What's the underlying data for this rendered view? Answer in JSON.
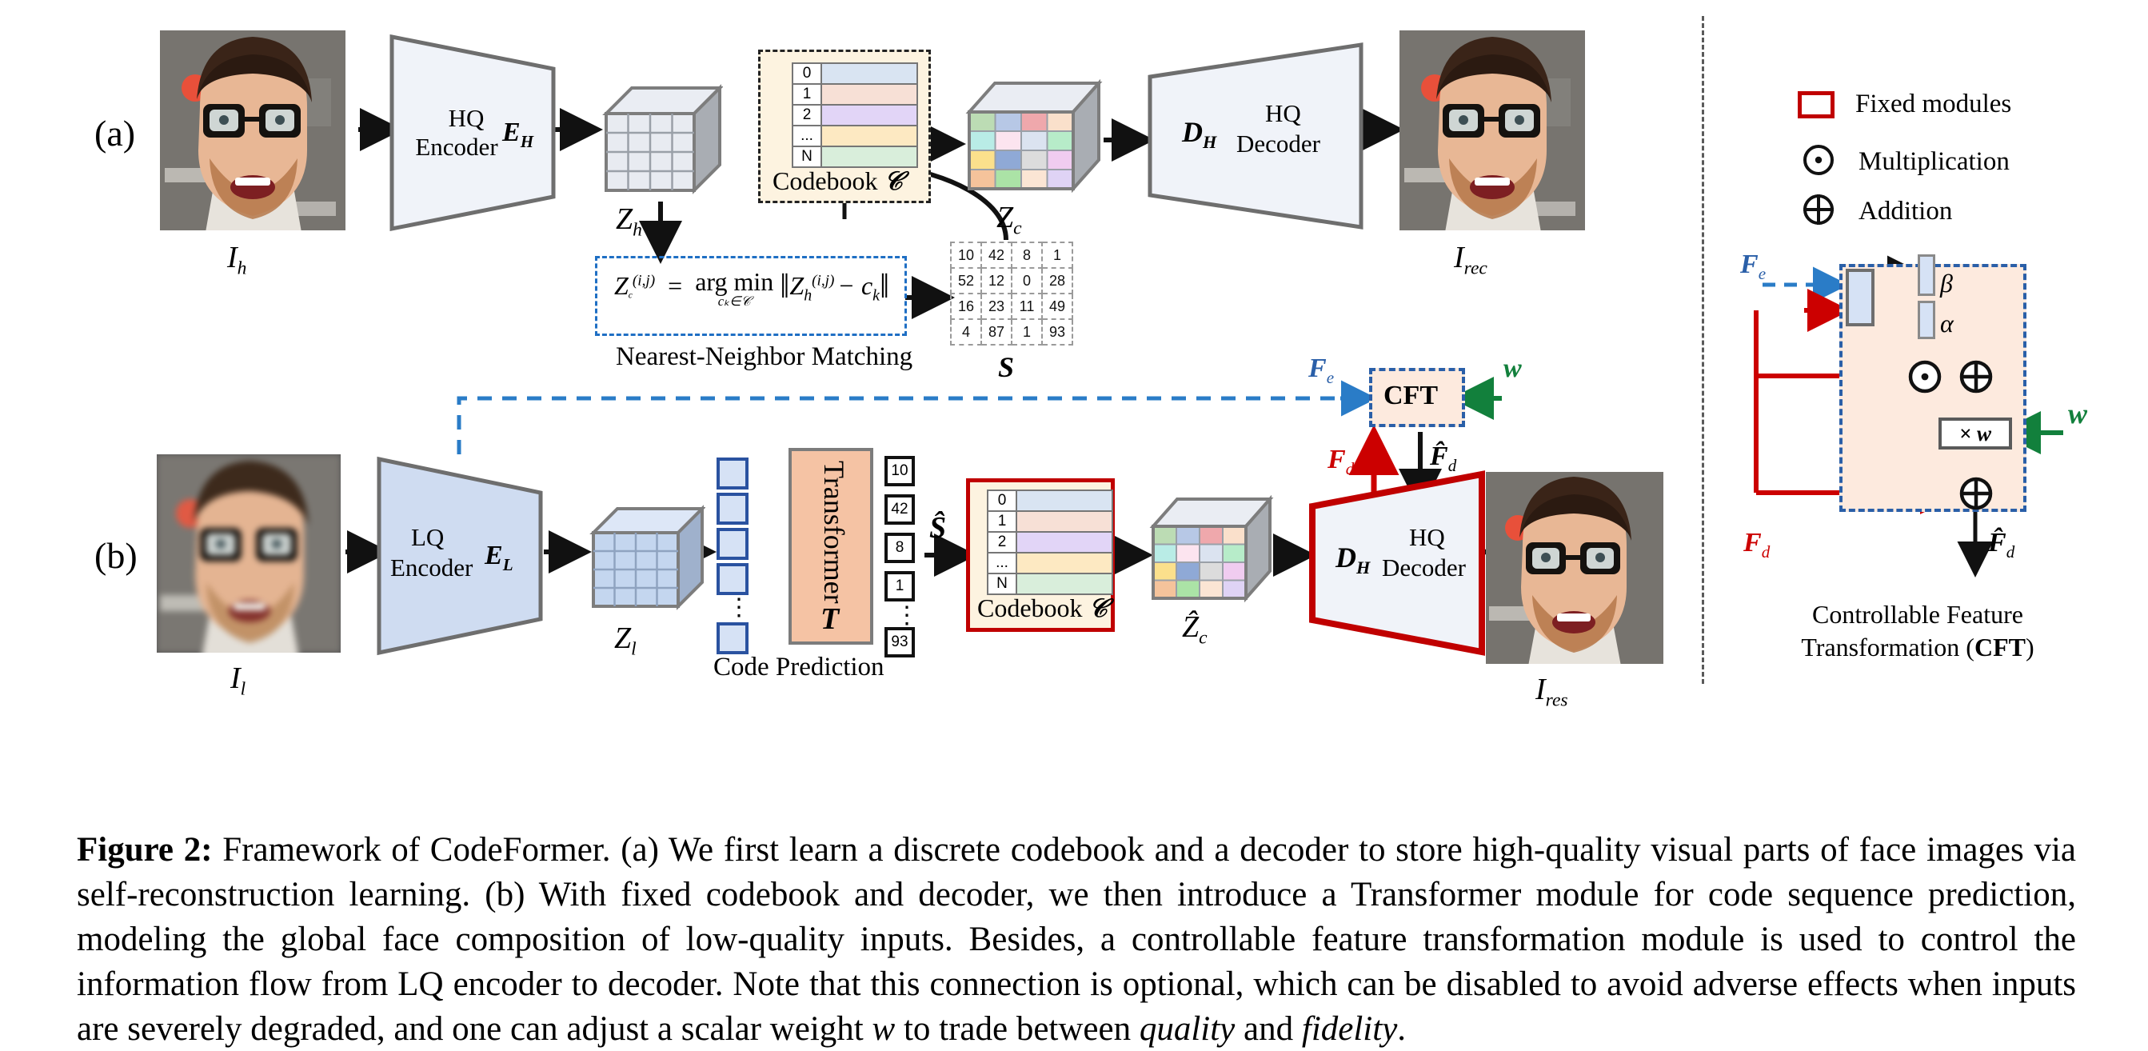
{
  "figure": {
    "number": "Figure 2:",
    "caption_rest": " Framework of CodeFormer. (a) We first learn a discrete codebook and a decoder to store high-quality visual parts of face images via self-reconstruction learning. (b) With fixed codebook and decoder, we then introduce a Transformer module for code sequence prediction, modeling the global face composition of low-quality inputs. Besides, a controllable feature transformation module is used to control the information flow from LQ encoder to decoder. Note that this connection is optional, which can be disabled to avoid adverse effects when inputs are severely degraded, and one can adjust a scalar weight ",
    "caption_w": "w",
    "caption_tail": " to trade between ",
    "caption_quality": "quality",
    "caption_and": " and ",
    "caption_fidelity": "fidelity",
    "caption_period": "."
  },
  "panel_a": {
    "tag": "(a)",
    "input_image_label": "I",
    "input_image_sub": "h",
    "encoder_line1": "HQ",
    "encoder_line2": "Encoder",
    "encoder_symbol": "E",
    "encoder_symbol_sub": "H",
    "latent_label": "Z",
    "latent_label_sub": "h",
    "equation": {
      "lhs": "Z",
      "lhs_sub": "c",
      "lhs_sup": "(i,j)",
      "eq": "=",
      "argmin": "arg min",
      "argmin_sub": "cₖ∈𝒞",
      "norm_open": "‖",
      "rhs": "Z",
      "rhs_sub": "h",
      "rhs_sup": "(i,j)",
      "minus": "− c",
      "minus_sub": "k",
      "norm_close": "‖",
      "caption": "Nearest-Neighbor Matching"
    },
    "codebook_label": "Codebook",
    "codebook_symbol": "𝒞",
    "codebook_rows": [
      "0",
      "1",
      "2",
      "...",
      "N"
    ],
    "codebook_colors": [
      "#d9e4f2",
      "#f7e0d6",
      "#e2d5f7",
      "#fde9c2",
      "#d9eedb"
    ],
    "s_label": "S",
    "s_matrix": [
      [
        10,
        42,
        8,
        1
      ],
      [
        52,
        12,
        0,
        28
      ],
      [
        16,
        23,
        11,
        49
      ],
      [
        4,
        87,
        1,
        93
      ]
    ],
    "zc_label": "Z",
    "zc_label_sub": "c",
    "decoder_symbol": "D",
    "decoder_symbol_sub": "H",
    "decoder_line1": "HQ",
    "decoder_line2": "Decoder",
    "output_image_label": "I",
    "output_image_sub": "rec"
  },
  "panel_b": {
    "tag": "(b)",
    "input_image_label": "I",
    "input_image_sub": "l",
    "encoder_line1": "LQ",
    "encoder_line2": "Encoder",
    "encoder_symbol": "E",
    "encoder_symbol_sub": "L",
    "latent_label": "Z",
    "latent_label_sub": "l",
    "transformer_label": "Transformer",
    "transformer_symbol": "T",
    "code_prediction_caption": "Code Prediction",
    "predicted_tokens": [
      "10",
      "42",
      "8",
      "1",
      "⋮",
      "93"
    ],
    "s_hat_label": "Ŝ",
    "codebook_label": "Codebook",
    "codebook_symbol": "𝒞",
    "codebook_rows": [
      "0",
      "1",
      "2",
      "...",
      "N"
    ],
    "codebook_colors": [
      "#d9e4f2",
      "#f7e0d6",
      "#e2d5f7",
      "#fde9c2",
      "#d9eedb"
    ],
    "zc_hat_label": "Ẑ",
    "zc_hat_sub": "c",
    "decoder_symbol": "D",
    "decoder_symbol_sub": "H",
    "decoder_line1": "HQ",
    "decoder_line2": "Decoder",
    "cft_box_label": "CFT",
    "fe_label": "F",
    "fe_sub": "e",
    "fd_label": "F",
    "fd_sub": "d",
    "fd_hat_label": "F̂",
    "fd_hat_sub": "d",
    "w_label": "w",
    "output_image_label": "I",
    "output_image_sub": "res"
  },
  "legend": {
    "items": [
      {
        "icon": "red-square-icon",
        "label": "Fixed modules"
      },
      {
        "icon": "multiplication-icon",
        "label": "Multiplication"
      },
      {
        "icon": "addition-icon",
        "label": "Addition"
      }
    ]
  },
  "cft_detail": {
    "fe_label": "F",
    "fe_sub": "e",
    "fd_label": "F",
    "fd_sub": "d",
    "fd_hat_label": "F̂",
    "fd_hat_sub": "d",
    "beta": "β",
    "alpha": "α",
    "times_w": "× w",
    "w_label": "w",
    "title_line1": "Controllable Feature",
    "title_line2": "Transformation (",
    "title_bold": "CFT",
    "title_line3": ")"
  },
  "colors": {
    "fixed_module_red": "#c00000",
    "encoder_blue": "#cfdcf1",
    "transformer_orange": "#f5c3a4",
    "cft_bg": "#fdeade",
    "dashed_blue": "#1f6fc4",
    "w_green": "#12803c",
    "fd_red": "#cc0000"
  },
  "zc_cube_colors": [
    [
      "#bcdcb4",
      "#b7c8e6",
      "#efa8ac",
      "#fae0cb"
    ],
    [
      "#b9ece6",
      "#fce4ef",
      "#dbe3f0",
      "#b7ecc9"
    ],
    [
      "#fbe08c",
      "#8fa9d6",
      "#dcdcdc",
      "#f0ccf0"
    ],
    [
      "#f5c39b",
      "#abe3a6",
      "#fbe5d4",
      "#dfd3f5"
    ]
  ]
}
